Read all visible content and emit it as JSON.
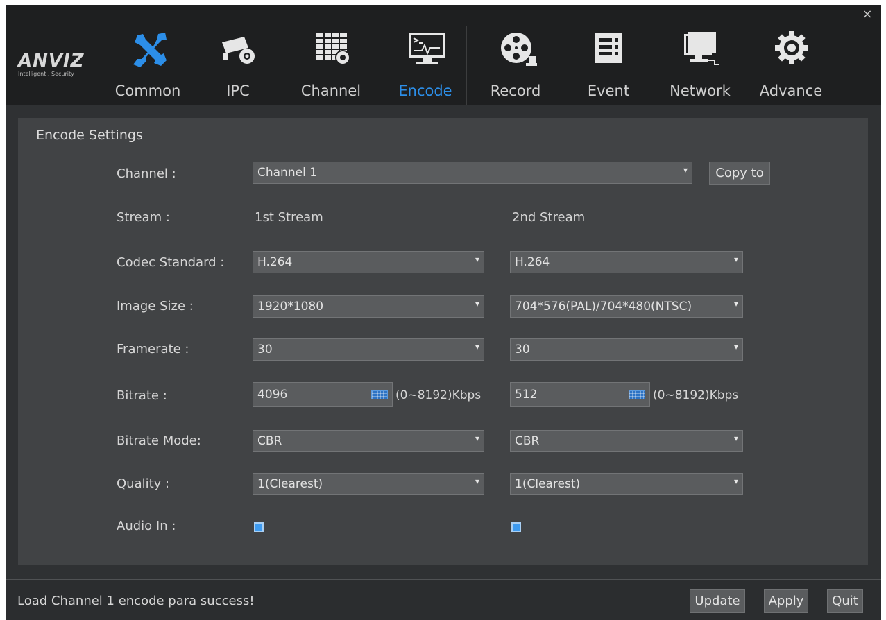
{
  "window": {
    "close_label": "×"
  },
  "brand": {
    "name": "ANVIZ",
    "tagline": "Intelligent . Security"
  },
  "nav": {
    "tabs": [
      {
        "label": "Common",
        "icon": "tools-icon"
      },
      {
        "label": "IPC",
        "icon": "camera-gear-icon"
      },
      {
        "label": "Channel",
        "icon": "channel-grid-icon"
      },
      {
        "label": "Encode",
        "icon": "encode-monitor-icon",
        "active": true
      },
      {
        "label": "Record",
        "icon": "film-reel-icon"
      },
      {
        "label": "Event",
        "icon": "event-list-icon"
      },
      {
        "label": "Network",
        "icon": "network-monitor-icon"
      },
      {
        "label": "Advance",
        "icon": "gear-icon"
      }
    ]
  },
  "encode": {
    "title": "Encode Settings",
    "channel_label": "Channel :",
    "channel_value": "Channel 1",
    "copy_to_label": "Copy to",
    "stream_label": "Stream :",
    "stream1_label": "1st Stream",
    "stream2_label": "2nd Stream",
    "codec_label": "Codec Standard :",
    "image_size_label": "Image Size :",
    "framerate_label": "Framerate :",
    "bitrate_label": "Bitrate :",
    "bitrate_mode_label": "Bitrate Mode:",
    "quality_label": "Quality :",
    "audio_label": "Audio In :",
    "bitrate_range": "(0~8192)Kbps",
    "stream1": {
      "codec": "H.264",
      "image_size": "1920*1080",
      "framerate": "30",
      "bitrate": "4096",
      "bitrate_mode": "CBR",
      "quality": "1(Clearest)",
      "audio_in": true
    },
    "stream2": {
      "codec": "H.264",
      "image_size": "704*576(PAL)/704*480(NTSC)",
      "framerate": "30",
      "bitrate": "512",
      "bitrate_mode": "CBR",
      "quality": "1(Clearest)",
      "audio_in": true
    }
  },
  "status": {
    "message": "Load Channel 1 encode para success!",
    "update_label": "Update",
    "apply_label": "Apply",
    "quit_label": "Quit"
  },
  "colors": {
    "accent": "#2c8ee8",
    "icon_blue": "#2c8ee8",
    "background": "#2f3133",
    "panel": "#414345"
  }
}
